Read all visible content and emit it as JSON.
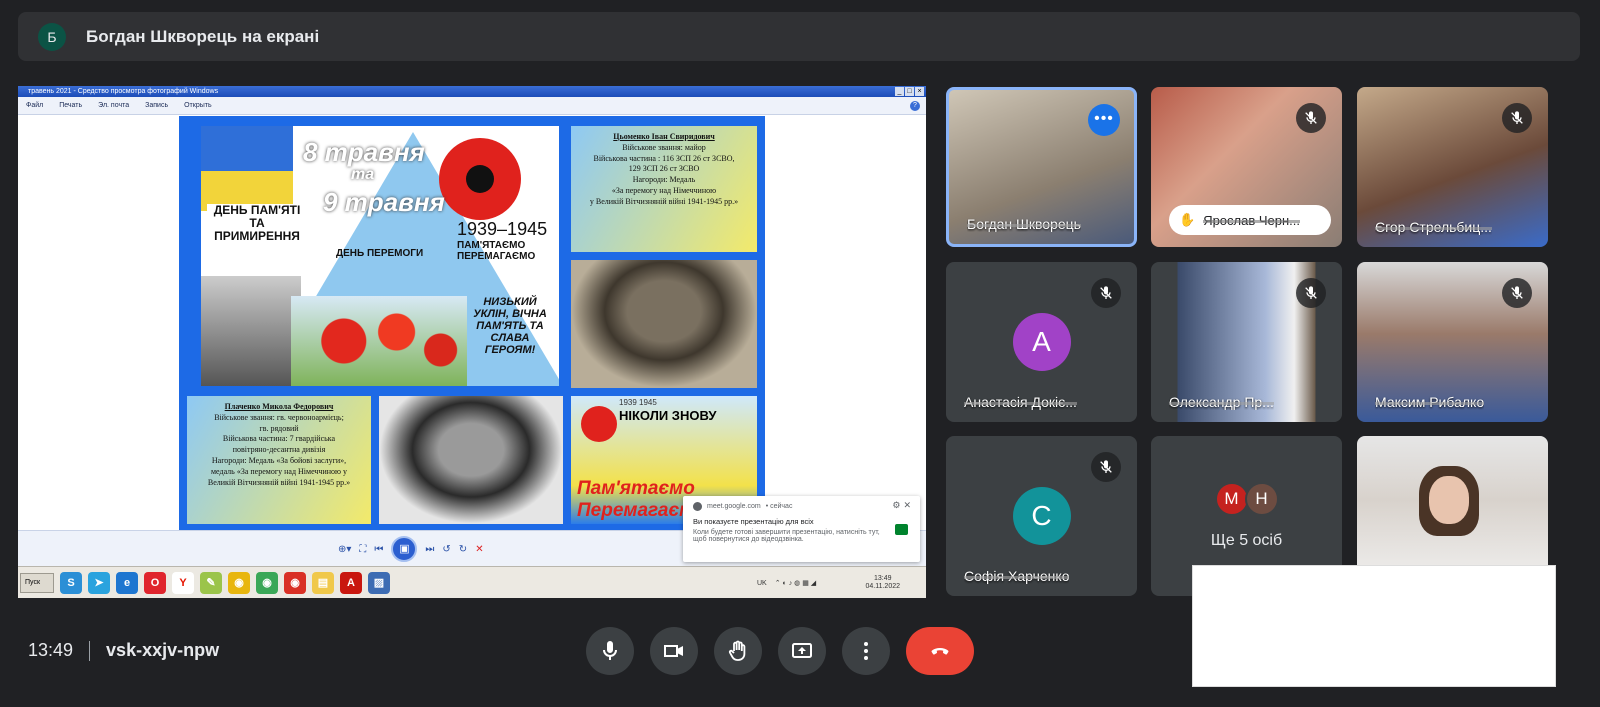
{
  "banner": {
    "avatar_letter": "Б",
    "text": "Богдан Шкворець на екрані"
  },
  "window": {
    "title": "травень 2021 - Средство просмотра фотографий Windows",
    "menu": [
      "Файл",
      "Печать",
      "Эл. почта",
      "Запись",
      "Открыть"
    ]
  },
  "poster": {
    "date1": "8 травня",
    "ta": "та",
    "date2": "9 травня",
    "day_memory": "ДЕНЬ ПАМ'ЯТІ ТА ПРИМИРЕННЯ",
    "years": "1939–1945",
    "remember": "ПАМ'ЯТАЄМО ПЕРЕМАГАЄМО",
    "victory_day": "ДЕНЬ ПЕРЕМОГИ",
    "bow": "НИЗЬКИЙ УКЛІН, ВІЧНА ПАМ'ЯТЬ ТА СЛАВА ГЕРОЯМ!",
    "card1": {
      "name": "Цьоменко Іван Свиридович",
      "lines": [
        "Військове звання: майор",
        "Військова частина : 116 ЗСП 26 ст ЗСВО,",
        "129 ЗСП 26 ст ЗСВО",
        "Нагороди: Медаль",
        "«За перемогу над Німеччиною",
        "у Великій Вітчизняній війні 1941-1945 рр.»"
      ]
    },
    "card2": {
      "name": "Плаченко Микола Федорович",
      "lines": [
        "Військове звання: гв. червоноармієць;",
        "гв. рядовий",
        "Військова частина: 7 гвардійська",
        "повітряно-десантна дивізія",
        "Нагороди: Медаль «За бойові заслуги»,",
        "медаль «За перемогу над Німеччиною у",
        "Великій Вітчизняній війні 1941-1945 рр.»"
      ]
    },
    "nikoly": "НІКОЛИ ЗНОВУ",
    "nikoly_years": "1939 1945",
    "pamyataemo": "Пам'ятаємо Перемагаємо"
  },
  "taskbar": {
    "start": "Пуск",
    "lang": "UK",
    "time": "13:49",
    "date": "04.11.2022"
  },
  "toast": {
    "source": "meet.google.com",
    "when": "• сейчас",
    "heading": "Ви показуєте презентацію для всіх",
    "body": "Коли будете готові завершити презентацію, натисніть тут, щоб повернутися до відеодзвінка."
  },
  "tiles": [
    {
      "name": "Богдан Шкворець"
    },
    {
      "name": "Ярослав Черн..."
    },
    {
      "name": "Єгор Стрельбиц..."
    },
    {
      "name": "Анастасія Докіє...",
      "letter": "А",
      "color": "#a142c7"
    },
    {
      "name": "Олександр Пр..."
    },
    {
      "name": "Максим Рибалко"
    },
    {
      "name": "Софія Харченко",
      "letter": "С",
      "color": "#12939a"
    }
  ],
  "others": {
    "a": "М",
    "b": "Н",
    "label": "Ще 5 осіб",
    "color_a": "#c5221f",
    "color_b": "#6d4c41"
  },
  "footer": {
    "time": "13:49",
    "meeting_code": "vsk-xxjv-npw"
  }
}
